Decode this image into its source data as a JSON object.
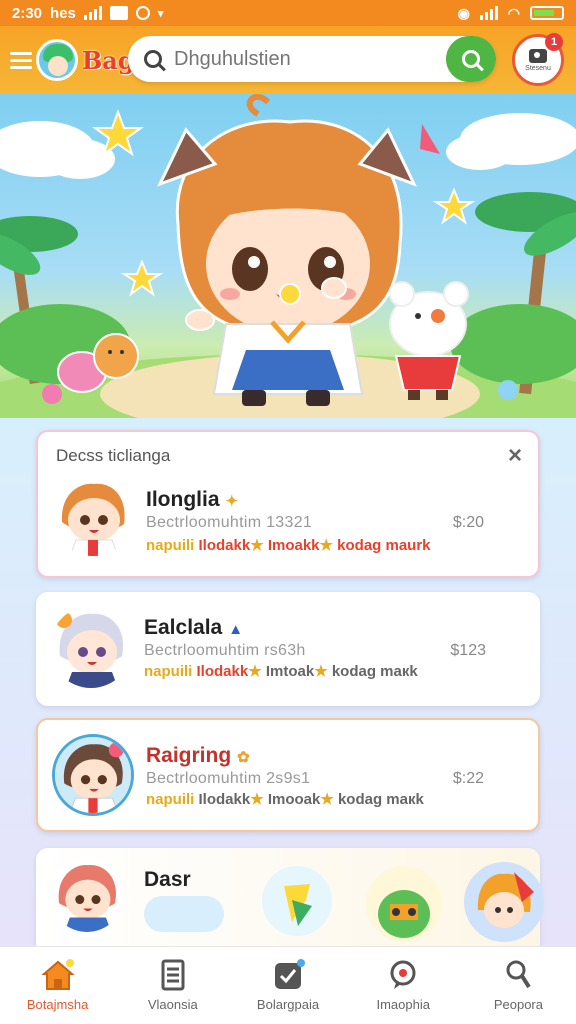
{
  "status_bar": {
    "time": "2:30",
    "carrier": "hes",
    "icons": [
      "signal-icon",
      "app-icon",
      "notification-icon",
      "wifi-icon",
      "battery-icon"
    ]
  },
  "header": {
    "logo_text": "Bagi",
    "search_placeholder": "Dhguhulstien",
    "profile_label": "Stesenu",
    "profile_badge": "1"
  },
  "recent": {
    "title": "Decss ticlianga",
    "close_label": "×"
  },
  "items": [
    {
      "name": "Ilonglia",
      "subtitle": "Bectrloomuhtim 13321",
      "price": "$:20",
      "tag_a": "napuili",
      "tag_b": "Ilodakk",
      "tag_c": "Imoakk",
      "tag_d": "kodag maurk",
      "mark": "✦"
    },
    {
      "name": "Ealclala",
      "subtitle": "Bectrloomuhtim rs63h",
      "price": "$123",
      "tag_a": "napuili",
      "tag_b": "Ilodakk",
      "tag_c": "Imtoak",
      "tag_d": "kodag maкk",
      "mark": "▲"
    },
    {
      "name": "Raigring",
      "subtitle": "Bectrloomuhtim 2s9s1",
      "price": "$:22",
      "tag_a": "napuili",
      "tag_b": "Ilodakk",
      "tag_c": "Imooak",
      "tag_d": "kodag maкk",
      "mark": "✿"
    }
  ],
  "featured": {
    "title": "Dasr"
  },
  "nav": [
    {
      "label": "Botajmsha",
      "icon": "home-icon",
      "active": true
    },
    {
      "label": "Vlaonsia",
      "icon": "document-icon",
      "active": false
    },
    {
      "label": "Bolargpaia",
      "icon": "check-box-icon",
      "active": false
    },
    {
      "label": "Imaophia",
      "icon": "chat-bubble-icon",
      "active": false
    },
    {
      "label": "Peopora",
      "icon": "person-icon",
      "active": false
    }
  ],
  "colors": {
    "status_bg": "#f28a1f",
    "header_bg": "#f7a326",
    "search_button": "#4fb543",
    "active_nav": "#e8572c",
    "tag_yellow": "#e8a91b",
    "tag_red": "#e8412b"
  }
}
